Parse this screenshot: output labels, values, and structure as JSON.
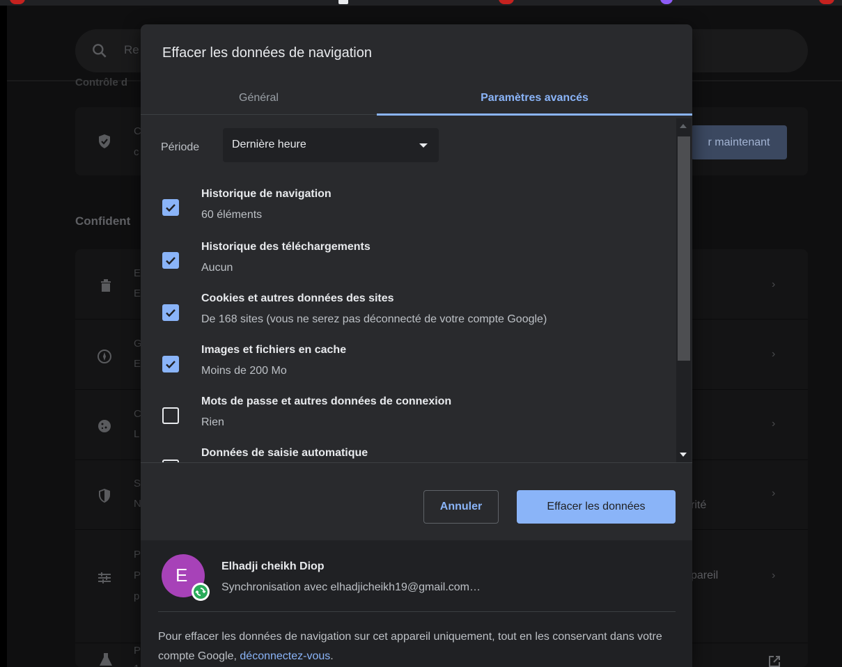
{
  "background": {
    "search_placeholder": "Re",
    "section_controle": "Contrôle d",
    "card_letter_1": "C",
    "card_letter_1b": "c",
    "card_button": "r maintenant",
    "section_confidentialite": "Confident",
    "rows": [
      {
        "icon": "trash-icon",
        "letters": [
          "E",
          "E"
        ],
        "right": ""
      },
      {
        "icon": "compass-icon",
        "letters": [
          "G",
          "E"
        ],
        "right": ""
      },
      {
        "icon": "cookie-icon",
        "letters": [
          "C",
          "L"
        ],
        "right": ""
      },
      {
        "icon": "shield-icon",
        "letters": [
          "S",
          "N"
        ],
        "right": "rité"
      },
      {
        "icon": "sliders-icon",
        "letters": [
          "P",
          "P",
          "p"
        ],
        "right": "pareil"
      },
      {
        "icon": "flask-icon",
        "letters": [
          "P",
          "1"
        ],
        "right": ""
      }
    ]
  },
  "dialog": {
    "title": "Effacer les données de navigation",
    "tabs": {
      "general": "Général",
      "advanced": "Paramètres avancés"
    },
    "periode": {
      "label": "Période",
      "selected": "Dernière heure"
    },
    "items": [
      {
        "title": "Historique de navigation",
        "subtitle": "60 éléments",
        "checked": true
      },
      {
        "title": "Historique des téléchargements",
        "subtitle": "Aucun",
        "checked": true
      },
      {
        "title": "Cookies et autres données des sites",
        "subtitle": "De 168 sites (vous ne serez pas déconnecté de votre compte Google)",
        "checked": true
      },
      {
        "title": "Images et fichiers en cache",
        "subtitle": "Moins de 200 Mo",
        "checked": true
      },
      {
        "title": "Mots de passe et autres données de connexion",
        "subtitle": "Rien",
        "checked": false
      },
      {
        "title": "Données de saisie automatique",
        "subtitle": "",
        "checked": false
      }
    ],
    "buttons": {
      "cancel": "Annuler",
      "clear": "Effacer les données"
    },
    "account": {
      "avatar_letter": "E",
      "name": "Elhadji cheikh Diop",
      "sync": "Synchronisation avec elhadjicheikh19@gmail.com…",
      "note_before": "Pour effacer les données de navigation sur cet appareil uniquement, tout en les conservant dans votre compte Google, ",
      "note_link": "déconnectez-vous",
      "note_after": "."
    }
  },
  "colors": {
    "accent": "#8ab4f8",
    "dialog_bg": "#292a2d",
    "footer_bg": "#202124",
    "avatar": "#a742b8",
    "sync_badge": "#2aab5a"
  }
}
